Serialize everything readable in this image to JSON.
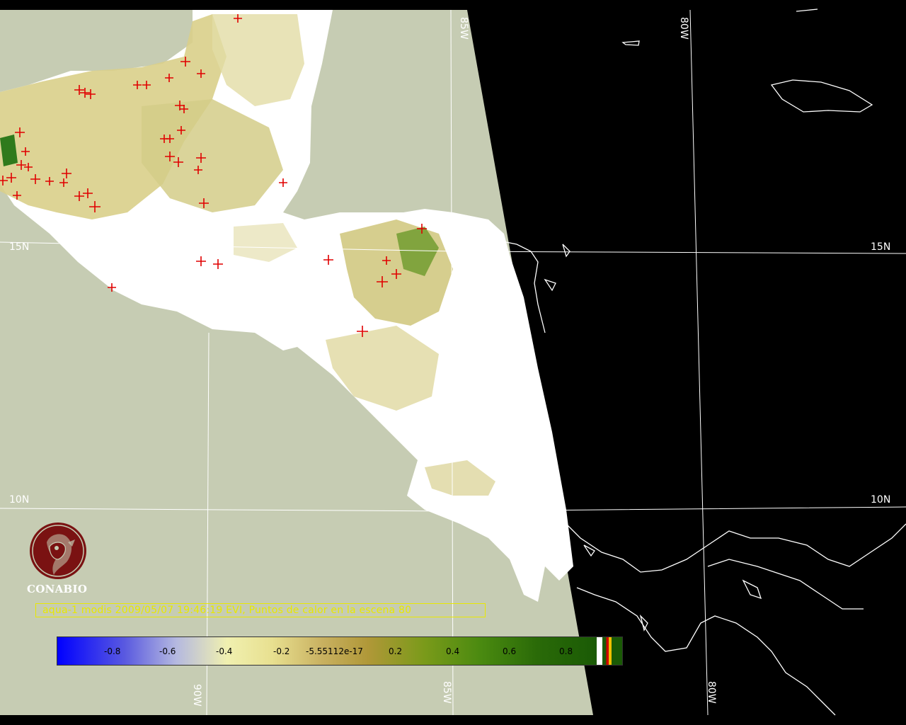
{
  "map": {
    "colors": {
      "land_bg": "#c6ccb3",
      "ocean_bg": "#000000",
      "cloud": "#ffffff",
      "fire": "#e00000",
      "grid": "#ffffff"
    },
    "grid_labels": {
      "lat_15n_left": "15N",
      "lat_15n_right": "15N",
      "lat_10n_left": "10N",
      "lat_10n_right": "10N",
      "lon_85w_top": "85W",
      "lon_80w_top": "80W",
      "lon_90w_bottom": "90W",
      "lon_85w_bottom": "85W",
      "lon_80w_bottom": "80W"
    }
  },
  "logo": {
    "icon": "conabio-macaw-logo",
    "text": "CONABIO"
  },
  "caption": "aqua-1 modis 2009/05/07 19:46:19 EVI, Puntos de calor en la escena 80",
  "colorbar": {
    "tick_labels": [
      "-0.8",
      "-0.6",
      "-0.4",
      "-0.2",
      "-5.55112e-17",
      "0.2",
      "0.4",
      "0.6",
      "0.8"
    ]
  }
}
